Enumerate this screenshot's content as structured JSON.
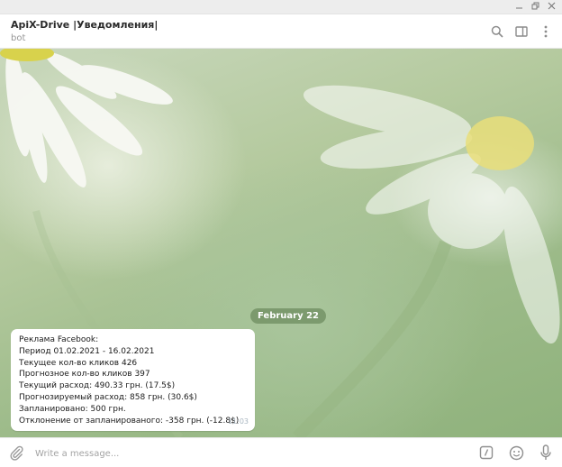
{
  "window": {
    "controls": [
      "minimize-icon",
      "restore-icon",
      "close-icon"
    ]
  },
  "header": {
    "title": "ApiX-Drive |Уведомления|",
    "status": "bot",
    "icons": [
      "search-icon",
      "sidebar-icon",
      "more-vertical-icon"
    ]
  },
  "chat": {
    "date_label": "February 22",
    "message": {
      "lines": [
        "Реклама Facebook:",
        "Период 01.02.2021 - 16.02.2021",
        "Текущее кол-во кликов 426",
        "Прогнозное кол-во кликов 397",
        "Текущий расход: 490.33 грн. (17.5$)",
        "Прогнозируемый расход: 858 грн. (30.6$)",
        "Запланировано: 500 грн.",
        "Отклонение от запланированого: -358 грн.  (-12.8$)"
      ],
      "time": "11:03"
    }
  },
  "composer": {
    "placeholder": "Write a message...",
    "icons": [
      "paperclip-icon",
      "bot-command-icon",
      "emoji-icon",
      "microphone-icon"
    ]
  },
  "colors": {
    "background_green": "#a9c59c",
    "date_pill": "#6e8c5f",
    "timestamp": "#a9b6c0"
  }
}
